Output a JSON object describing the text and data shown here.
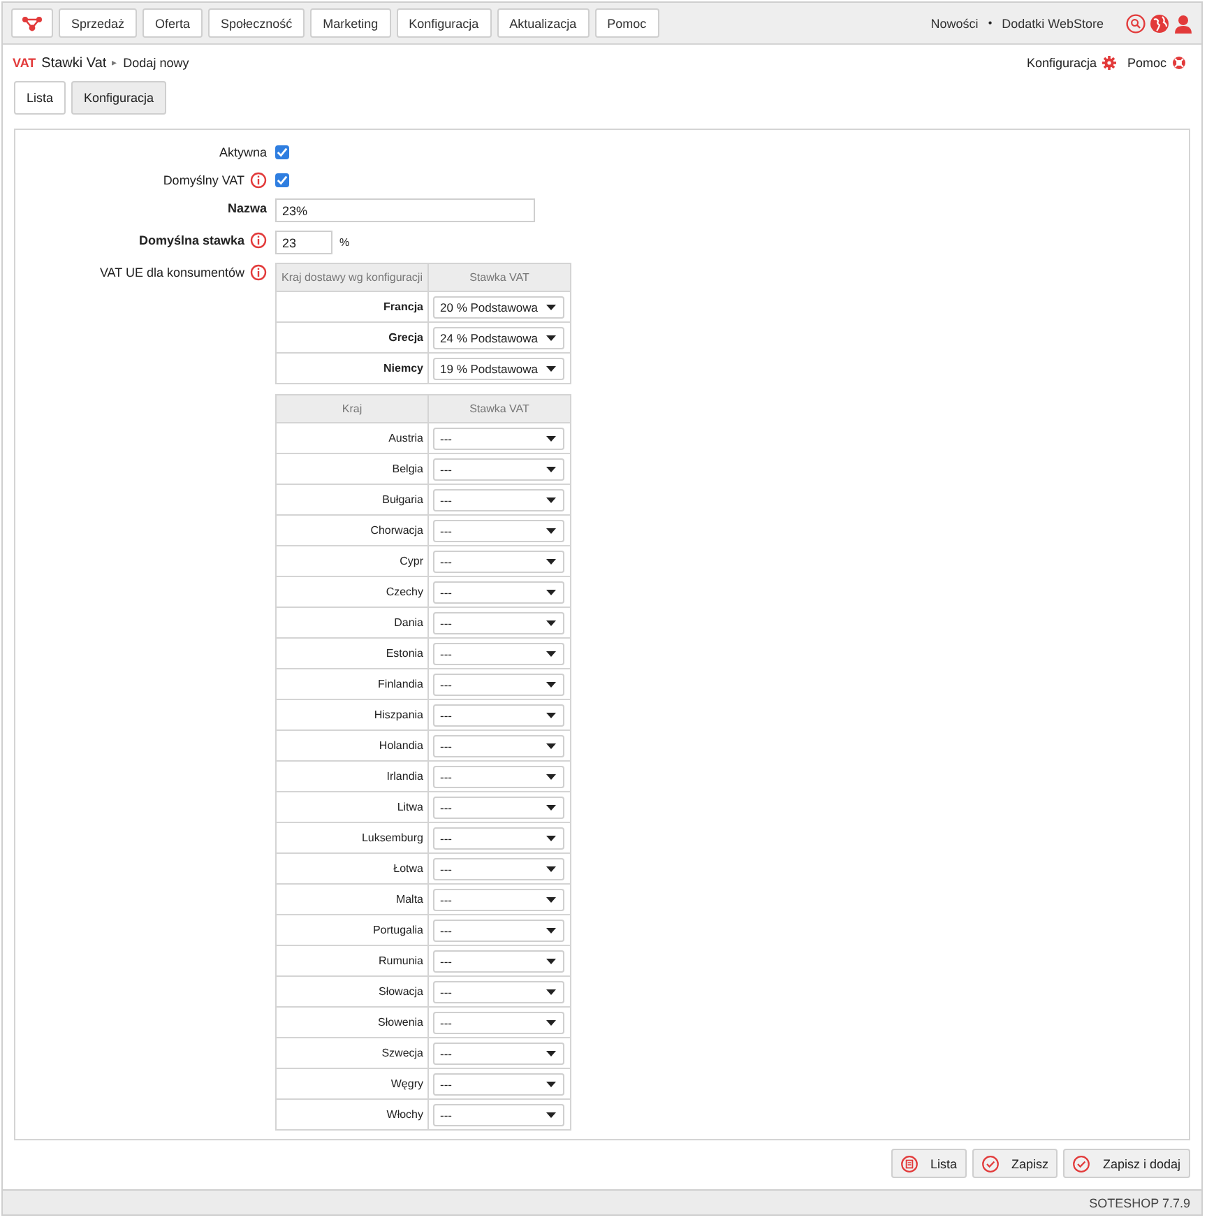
{
  "top_nav": {
    "items": [
      "Sprzedaż",
      "Oferta",
      "Społeczność",
      "Marketing",
      "Konfiguracja",
      "Aktualizacja",
      "Pomoc"
    ],
    "links": [
      "Nowości",
      "•",
      "Dodatki WebStore"
    ]
  },
  "breadcrumb": {
    "badge": "VAT",
    "title": "Stawki Vat",
    "separator": "▸",
    "current": "Dodaj nowy"
  },
  "header_links": [
    "Konfiguracja",
    "Pomoc"
  ],
  "tabs": [
    {
      "label": "Lista",
      "selected": false
    },
    {
      "label": "Konfiguracja",
      "selected": true
    }
  ],
  "form": [
    {
      "kind": "checkbox",
      "label": "Aktywna",
      "bold": false,
      "info": false,
      "checked": true
    },
    {
      "kind": "checkbox",
      "label": "Domyślny VAT",
      "bold": false,
      "info": true,
      "checked": true
    },
    {
      "kind": "text",
      "label": "Nazwa",
      "bold": true,
      "info": false,
      "value": "23%"
    },
    {
      "kind": "number",
      "label": "Domyślna stawka",
      "bold": true,
      "info": true,
      "value": "23",
      "unit": "%"
    },
    {
      "kind": "tables",
      "label": "VAT UE dla konsumentów",
      "bold": false,
      "info": true
    }
  ],
  "config_table": {
    "columns": [
      "Kraj dostawy wg konfiguracji",
      "Stawka VAT"
    ],
    "rows": [
      {
        "country": "Francja",
        "rate": "20 % Podstawowa"
      },
      {
        "country": "Grecja",
        "rate": "24 % Podstawowa"
      },
      {
        "country": "Niemcy",
        "rate": "19 % Podstawowa"
      }
    ]
  },
  "country_table": {
    "columns": [
      "Kraj",
      "Stawka VAT"
    ],
    "rows": [
      {
        "country": "Austria",
        "rate": "---"
      },
      {
        "country": "Belgia",
        "rate": "---"
      },
      {
        "country": "Bułgaria",
        "rate": "---"
      },
      {
        "country": "Chorwacja",
        "rate": "---"
      },
      {
        "country": "Cypr",
        "rate": "---"
      },
      {
        "country": "Czechy",
        "rate": "---"
      },
      {
        "country": "Dania",
        "rate": "---"
      },
      {
        "country": "Estonia",
        "rate": "---"
      },
      {
        "country": "Finlandia",
        "rate": "---"
      },
      {
        "country": "Hiszpania",
        "rate": "---"
      },
      {
        "country": "Holandia",
        "rate": "---"
      },
      {
        "country": "Irlandia",
        "rate": "---"
      },
      {
        "country": "Litwa",
        "rate": "---"
      },
      {
        "country": "Luksemburg",
        "rate": "---"
      },
      {
        "country": "Łotwa",
        "rate": "---"
      },
      {
        "country": "Malta",
        "rate": "---"
      },
      {
        "country": "Portugalia",
        "rate": "---"
      },
      {
        "country": "Rumunia",
        "rate": "---"
      },
      {
        "country": "Słowacja",
        "rate": "---"
      },
      {
        "country": "Słowenia",
        "rate": "---"
      },
      {
        "country": "Szwecja",
        "rate": "---"
      },
      {
        "country": "Węgry",
        "rate": "---"
      },
      {
        "country": "Włochy",
        "rate": "---"
      }
    ]
  },
  "actions": [
    {
      "kind": "list",
      "label": "Lista"
    },
    {
      "kind": "save",
      "label": "Zapisz"
    },
    {
      "kind": "save",
      "label": "Zapisz i dodaj"
    }
  ],
  "status_bar": "SOTESHOP 7.7.9"
}
